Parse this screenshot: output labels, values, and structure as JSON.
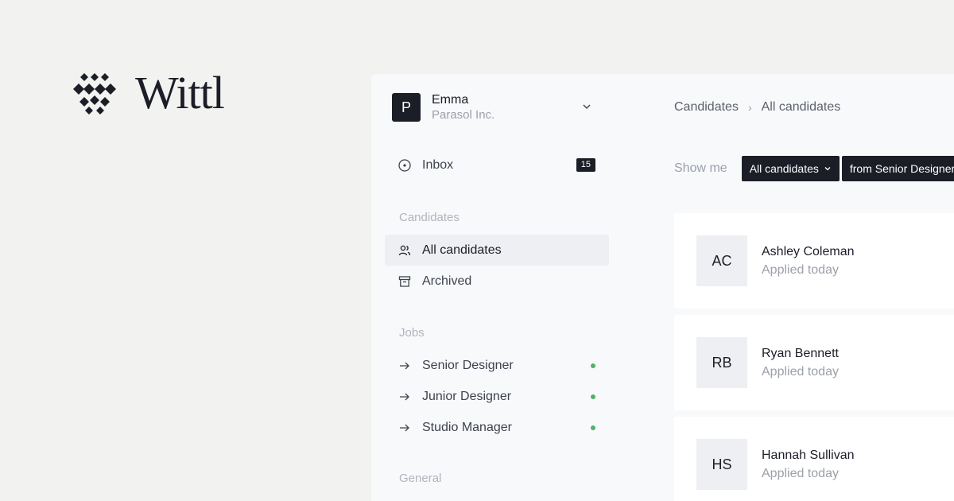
{
  "brand": {
    "name": "Wittl"
  },
  "workspace": {
    "avatar_letter": "P",
    "user_name": "Emma",
    "org_name": "Parasol Inc."
  },
  "sidebar": {
    "inbox": {
      "label": "Inbox",
      "count": "15",
      "icon": "inbox-icon"
    },
    "candidates_section": "Candidates",
    "candidates_items": [
      {
        "label": "All candidates",
        "icon": "users-icon",
        "active": true
      },
      {
        "label": "Archived",
        "icon": "archive-icon",
        "active": false
      }
    ],
    "jobs_section": "Jobs",
    "jobs": [
      {
        "label": "Senior Designer",
        "status_color": "#52b06b"
      },
      {
        "label": "Junior Designer",
        "status_color": "#52b06b"
      },
      {
        "label": "Studio Manager",
        "status_color": "#52b06b"
      }
    ],
    "general_section": "General"
  },
  "main": {
    "breadcrumb": [
      "Candidates",
      "All candidates"
    ],
    "filter_label": "Show me",
    "filter_chips": [
      "All candidates",
      "from Senior Designer"
    ],
    "candidates": [
      {
        "initials": "AC",
        "name": "Ashley Coleman",
        "status": "Applied today"
      },
      {
        "initials": "RB",
        "name": "Ryan Bennett",
        "status": "Applied today"
      },
      {
        "initials": "HS",
        "name": "Hannah Sullivan",
        "status": "Applied today"
      }
    ]
  },
  "colors": {
    "background": "#f2f2f0",
    "dark": "#1b1e27",
    "muted": "#9ba0aa",
    "status_green": "#52b06b"
  }
}
